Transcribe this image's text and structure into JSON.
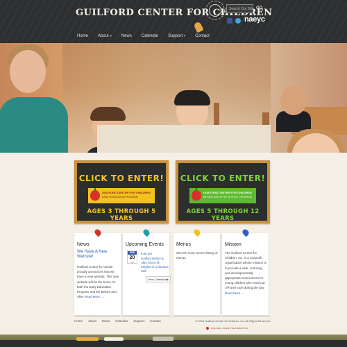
{
  "header": {
    "site_title": "GUILFORD CENTER FOR CHILDREN",
    "search_placeholder": "Search Our Site",
    "search_button": "GO",
    "accreditation": "naeyc"
  },
  "nav": {
    "items": [
      {
        "label": "Home",
        "has_dropdown": false
      },
      {
        "label": "About",
        "has_dropdown": true
      },
      {
        "label": "News",
        "has_dropdown": false
      },
      {
        "label": "Calendar",
        "has_dropdown": false
      },
      {
        "label": "Support",
        "has_dropdown": true
      },
      {
        "label": "Contact",
        "has_dropdown": false
      }
    ],
    "caret": "▾"
  },
  "programs": {
    "left": {
      "cta": "CLICK TO ENTER!",
      "name": "GUILFORD CENTER FOR CHILDREN",
      "subtitle": "EARLY EDUCATION PROGRAM",
      "ages": "AGES 3 THROUGH 5 YEARS"
    },
    "right": {
      "cta": "CLICK TO ENTER!",
      "name": "GUILFORD CENTER FOR CHILDREN",
      "subtitle": "BEFORE AND AFTER SCHOOL PROGRAM",
      "ages": "AGES 5 THROUGH 12 YEARS"
    }
  },
  "cards": {
    "news": {
      "title": "News",
      "headline": "We Have A New Website!",
      "body": "Guilford Center for Center proudly announces that we have a new website. This new website will be the home for both the Early Education Program and the Before and After",
      "read_more": "Read More →"
    },
    "events": {
      "title": "Upcoming Events",
      "month": "FEB",
      "day": "20",
      "dow": "FRI",
      "time": "5:00 pm",
      "event_title": "Guilford Before & After Event @ Knights of Columbus Hall",
      "view_calendar": "View Calendar ▶"
    },
    "menus": {
      "title": "Menus",
      "body": "See the most current listing of menus."
    },
    "mission": {
      "title": "Mission",
      "body": "The Guilford Center for Children, Inc. is a nonprofit organization whose mission is to provide a safe, nurturing, and developmentally appropriate environment for young children who need out-of-home care during the day.",
      "read_more": "Read More →"
    }
  },
  "footer": {
    "links": [
      "Home",
      "About",
      "News",
      "Calendar",
      "Support",
      "Contact"
    ],
    "copyright": "© 2015 Guilford Center for Children, Inc. All Rights Reserved.",
    "credit": "MIRANDA CREATIVE WEBSITES"
  },
  "colors": {
    "header_bg": "#2f3132",
    "frame": "#c8923e",
    "yellow_accent": "#f2c22c",
    "green_accent": "#7ed13a",
    "link": "#2b65b4"
  }
}
